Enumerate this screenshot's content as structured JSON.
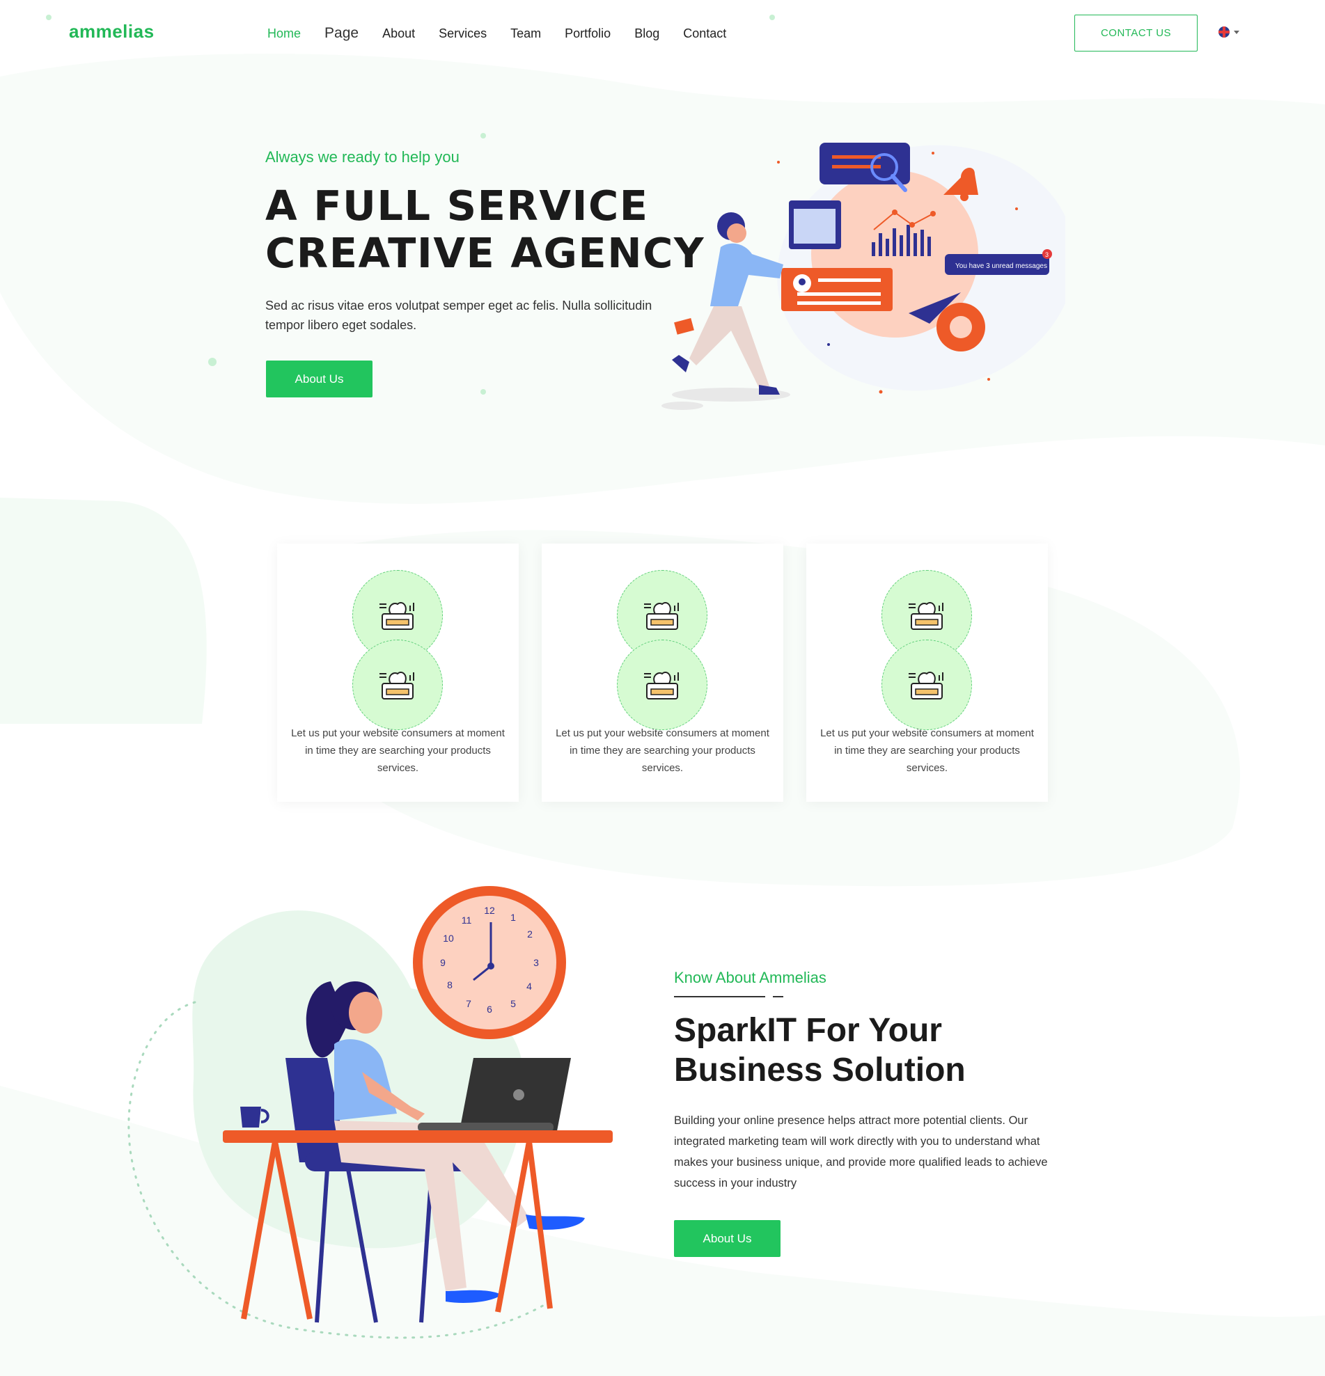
{
  "header": {
    "logo": "ammelias",
    "nav": [
      "Home",
      "Page",
      "About",
      "Services",
      "Team",
      "Portfolio",
      "Blog",
      "Contact"
    ],
    "active_nav": "Home",
    "contact_button": "CONTACT US",
    "language": "uk-flag-icon"
  },
  "hero": {
    "tagline": "Always we ready to help you",
    "title_line1": "A FULL SERVICE",
    "title_line2": "CREATIVE AGENCY",
    "text": "Sed ac risus vitae eros volutpat semper eget ac felis. Nulla sollicitudin tempor libero eget sodales.",
    "button": "About Us",
    "notification_text": "You have 3 unread messages",
    "notification_count": "3"
  },
  "cards": [
    {
      "icon": "robot-brain-icon",
      "text": "Let us put your website consumers at moment in time they are searching your products services."
    },
    {
      "icon": "robot-brain-icon",
      "text": "Let us put your website consumers at moment in time they are searching your products services."
    },
    {
      "icon": "robot-brain-icon",
      "text": "Let us put your website consumers at moment in time they are searching your products services."
    }
  ],
  "about": {
    "tagline": "Know About Ammelias",
    "title_line1": "SparkIT For Your",
    "title_line2": "Business Solution",
    "text": "Building your online presence helps attract more potential clients. Our integrated marketing team will work directly with you to understand what makes your business unique, and provide more qualified leads to achieve success in your industry",
    "button": "About Us",
    "clock_numbers": [
      "12",
      "1",
      "2",
      "3",
      "4",
      "5",
      "6",
      "7",
      "8",
      "9",
      "10",
      "11"
    ]
  },
  "colors": {
    "accent": "#22b857",
    "button": "#22c55e",
    "orange": "#ee5a28",
    "navy": "#2e3192",
    "peach": "#fdd1c0",
    "light_green": "#d6fbd2"
  }
}
